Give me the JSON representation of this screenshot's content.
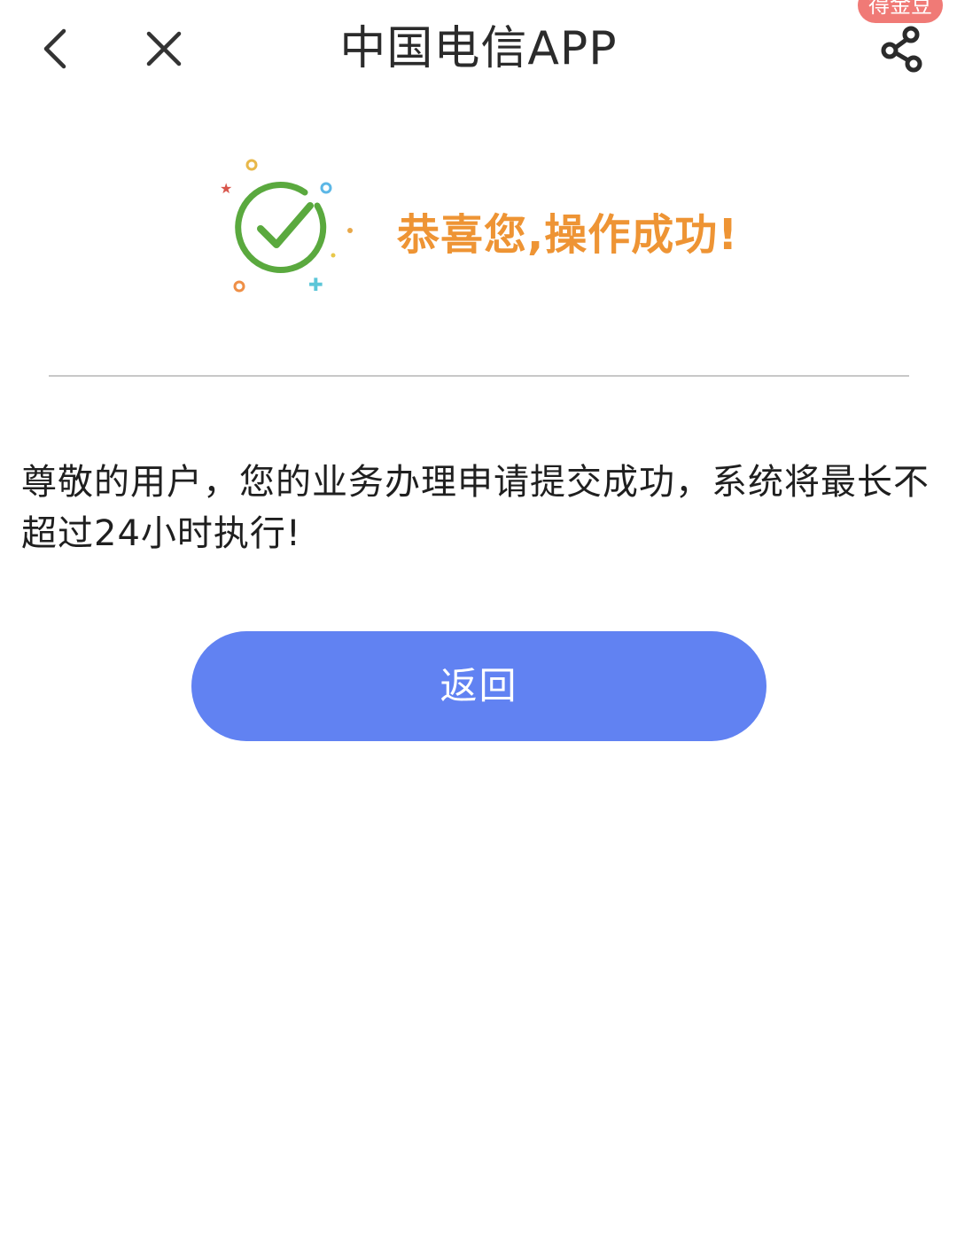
{
  "header": {
    "title": "中国电信APP",
    "reward_badge": "得金豆",
    "back_icon": "chevron-left-icon",
    "close_icon": "close-icon",
    "share_icon": "share-icon"
  },
  "result": {
    "icon": "success-check-icon",
    "title": "恭喜您,操作成功!",
    "title_color": "#ee9434",
    "icon_color": "#5aa93e"
  },
  "message": {
    "text": "尊敬的用户，您的业务办理申请提交成功，系统将最长不超过24小时执行!"
  },
  "actions": {
    "return_label": "返回",
    "return_color": "#6182f2"
  }
}
